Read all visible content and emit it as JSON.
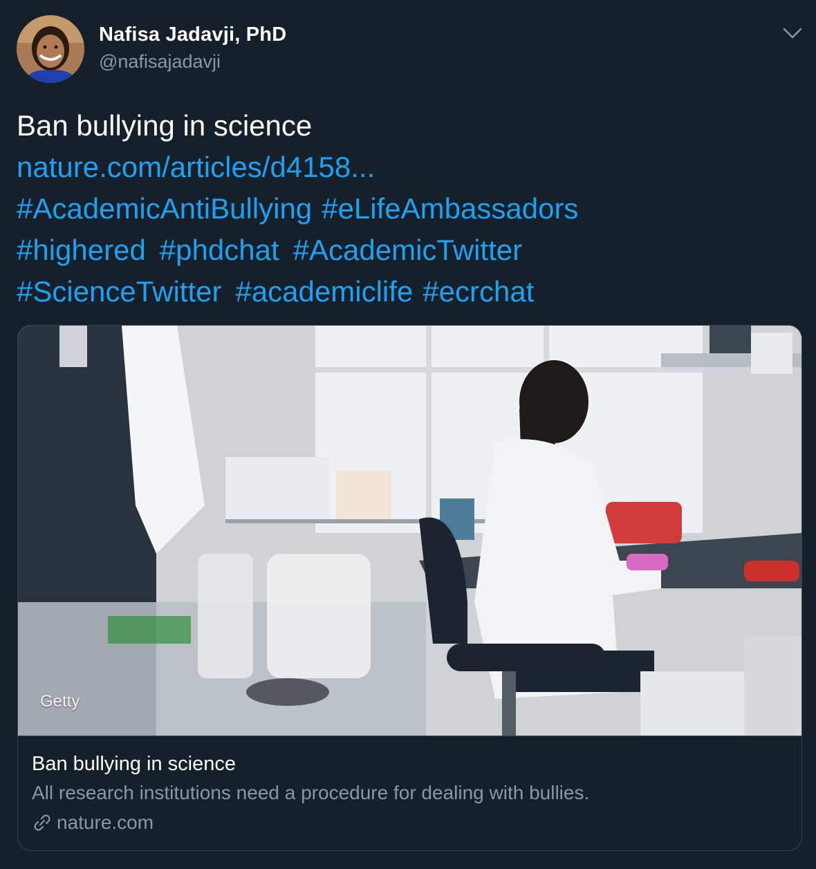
{
  "author": {
    "display_name": "Nafisa Jadavji, PhD",
    "handle": "@nafisajadavji",
    "avatar_icon": "profile-photo"
  },
  "menu": {
    "icon": "chevron-down-icon"
  },
  "tweet": {
    "text": "Ban bullying in science",
    "link": "nature.com/articles/d4158...",
    "hashtags_line1": [
      "#AcademicAntiBullying",
      "#eLifeAmbassadors"
    ],
    "hashtags_line2": [
      "#highered",
      "#phdchat",
      "#AcademicTwitter"
    ],
    "hashtags_line3": [
      "#ScienceTwitter",
      "#academiclife",
      "#ecrchat"
    ]
  },
  "card": {
    "image_credit": "Getty",
    "title": "Ban bullying in science",
    "description": "All research institutions need a procedure for dealing with bullies.",
    "domain": "nature.com",
    "domain_icon": "link-icon"
  },
  "colors": {
    "background": "#15202b",
    "link": "#1da1f2",
    "muted": "#8899a6",
    "border": "#38444d"
  }
}
